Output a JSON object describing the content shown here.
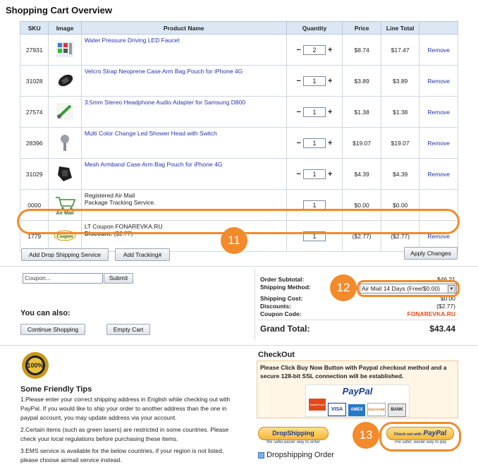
{
  "title": "Shopping Cart Overview",
  "columns": [
    "SKU",
    "Image",
    "Product Name",
    "Quantity",
    "Price",
    "Line Total",
    ""
  ],
  "rows": [
    {
      "sku": "27931",
      "name": "Water Pressure Driving LED Faucet",
      "qty": "2",
      "price": "$8.74",
      "total": "$17.47",
      "remove": "Remove"
    },
    {
      "sku": "31028",
      "name": "Velcro Strap Neoprene Case Arm Bag Pouch for iPhone 4G",
      "qty": "1",
      "price": "$3.89",
      "total": "$3.89",
      "remove": "Remove"
    },
    {
      "sku": "27574",
      "name": "3.5mm Stereo Headphone Audio Adapter for Samsung D800",
      "qty": "1",
      "price": "$1.38",
      "total": "$1.38",
      "remove": "Remove"
    },
    {
      "sku": "28396",
      "name": "Multi Color Change Led Shower Head with Switch",
      "qty": "1",
      "price": "$19.07",
      "total": "$19.07",
      "remove": "Remove"
    },
    {
      "sku": "31029",
      "name": "Mesh Armband Case Arm Bag Pouch for iPhone 4G",
      "qty": "1",
      "price": "$4.39",
      "total": "$4.39",
      "remove": "Remove"
    },
    {
      "sku": "0000",
      "name_line1": "Registered Air Mail",
      "name_line2": "Package Tracking Service.",
      "img_label": "Air Mail",
      "qty": "1",
      "price": "$0.00",
      "total": "$0.00"
    },
    {
      "sku": "1779",
      "name_line1": "LT Coupon FONAREVKA.RU",
      "discount_label": "Discount:",
      "discount_value": "($2.77)",
      "img_label": "Coupon",
      "qty": "1",
      "price": "($2.77)",
      "total": "($2.77)",
      "remove": "Remove"
    }
  ],
  "buttons": {
    "drop_shipping": "Add Drop Shipping Service",
    "tracking": "Add Tracking#",
    "apply": "Apply Changes",
    "submit": "Submit",
    "continue": "Continue Shopping",
    "empty": "Empty Cart"
  },
  "coupon_placeholder": "Coupon...",
  "you_can_also": "You can also:",
  "summary": {
    "subtotal_label": "Order Subtotal:",
    "subtotal_value": "$46.21",
    "method_label": "Shipping Method:",
    "method_value": "Air Mail 14 Days (Free/$0.00)",
    "cost_label": "Shipping Cost:",
    "cost_value": "$0.00",
    "discounts_label": "Discounts:",
    "discounts_value": "($2.77)",
    "coupon_label": "Coupon Code:",
    "coupon_value": "FONAREVKA.RU",
    "grand_label": "Grand Total:",
    "grand_value": "$43.44"
  },
  "checkout": {
    "heading": "CheckOut",
    "notice": "Please Click Buy Now Button with Paypal checkout method and a secure 128-bit SSL connection will be established.",
    "paypal": "PayPal",
    "cards": [
      "MasterCard",
      "VISA",
      "AMEX",
      "DISCOVER",
      "BANK"
    ],
    "dropship_btn": "DropShipping",
    "dropship_tag": "the safer,easier way to order",
    "dropship_order": "Dropshipping Order",
    "checkout_with": "Check out with",
    "checkout_tag": "The safer, easier way to pay"
  },
  "badge": "100%",
  "tips": {
    "heading": "Some Friendly Tips",
    "t1": "1.Please enter your correct shipping address in English while checking out with PayPal. If you would like to ship your order to another address than the one in paypal account, you may update address via your account.",
    "t2": "2.Certain items (such as green lasers) are restricted in some countries. Please check your local regulations before purchasing these items.",
    "t3": "3.EMS service is available for the below countries, if your region is not listed, please choose airmail service instead."
  },
  "annotations": [
    "11",
    "12",
    "13"
  ],
  "colors": {
    "accent": "#f38a2b",
    "link": "#2233aa",
    "coupon": "#e0501a",
    "header": "#dce7f4"
  }
}
